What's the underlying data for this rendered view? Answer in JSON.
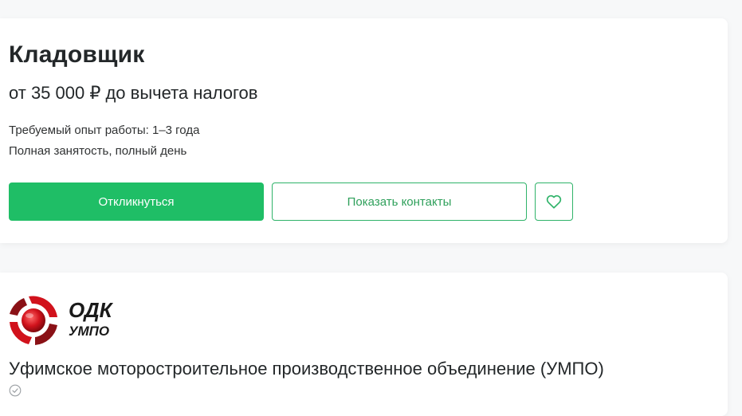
{
  "vacancy": {
    "title": "Кладовщик",
    "salary": "от 35 000 ₽ до вычета налогов",
    "experience": "Требуемый опыт работы: 1–3 года",
    "employment": "Полная занятость, полный день",
    "respond_button": "Откликнуться",
    "contacts_button": "Показать контакты",
    "favorite_icon": "heart-icon"
  },
  "company": {
    "logo": {
      "line1": "ОДК",
      "line2": "УМПО",
      "icon": "odk-emblem"
    },
    "name": "Уфимское моторостроительное производственное объединение (УМПО)",
    "verified_icon": "check-circle-icon"
  },
  "colors": {
    "accent": "#1fbe66",
    "outline": "#2fb369",
    "logo_red": "#d1121c",
    "text": "#232729"
  }
}
